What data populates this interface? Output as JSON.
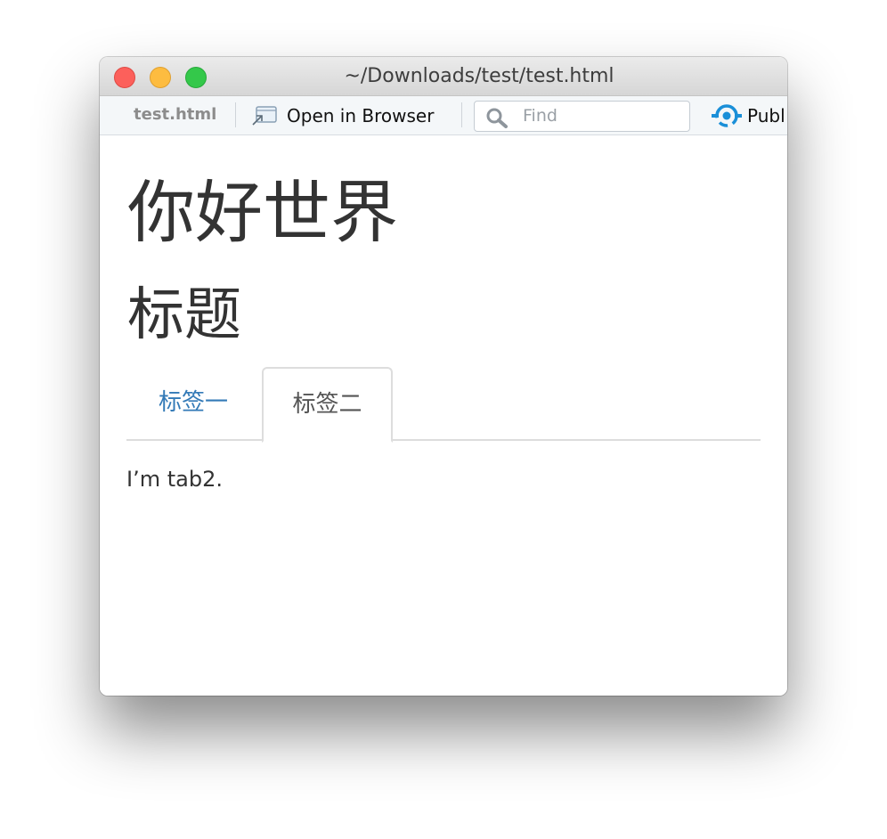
{
  "window": {
    "title": "~/Downloads/test/test.html"
  },
  "toolbar": {
    "file_tab": "test.html",
    "open_in_browser_label": "Open in Browser",
    "find_placeholder": "Find",
    "find_value": "",
    "publish_label": "Publ"
  },
  "page": {
    "heading1": "你好世界",
    "heading2": "标题",
    "tabs": [
      {
        "label": "标签一",
        "active": false
      },
      {
        "label": "标签二",
        "active": true
      }
    ],
    "active_tab_content": "I’m tab2."
  },
  "colors": {
    "tab_link": "#337ab7",
    "publish_icon": "#1a8fd8",
    "heading_text": "#333333"
  },
  "icons": {
    "open_in_browser": "open-in-browser-icon",
    "find": "search-icon",
    "publish": "publish-icon"
  }
}
